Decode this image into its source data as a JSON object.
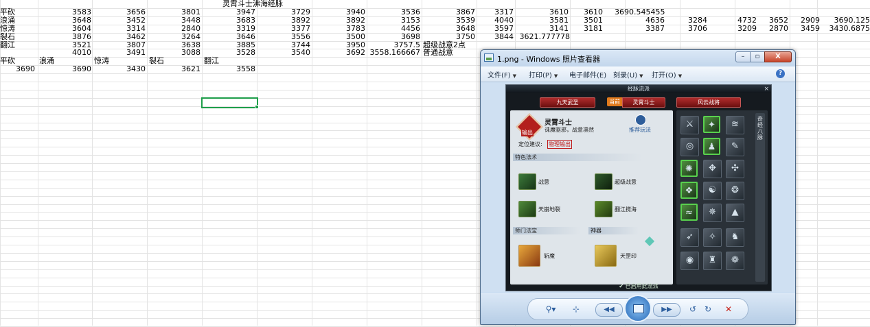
{
  "sheet": {
    "title": "灵霄斗士沸海经脉",
    "rows": [
      {
        "label": "平砍",
        "values": [
          "3583",
          "3656",
          "3801",
          "3947",
          "3729",
          "3940",
          "3536",
          "3867",
          "3317",
          "3610",
          "3610",
          "3690.545455"
        ]
      },
      {
        "label": "浪涌",
        "values": [
          "3648",
          "3452",
          "3448",
          "3683",
          "3892",
          "3892",
          "3153",
          "3539",
          "4040",
          "3581",
          "3501",
          "4636",
          "3284",
          "4732",
          "3652",
          "2909",
          "3690.125"
        ]
      },
      {
        "label": "惊涛",
        "values": [
          "3604",
          "3314",
          "2840",
          "3319",
          "3377",
          "3783",
          "4456",
          "3648",
          "3597",
          "3141",
          "3181",
          "3387",
          "3706",
          "3209",
          "2870",
          "3459",
          "3430.6875"
        ]
      },
      {
        "label": "裂石",
        "values": [
          "3876",
          "3462",
          "3264",
          "3646",
          "3556",
          "3500",
          "3698",
          "3750",
          "3844",
          "3621.777778"
        ]
      },
      {
        "label": "翻江",
        "values": [
          "3521",
          "3807",
          "3638",
          "3885",
          "3744",
          "3950",
          "3757.5"
        ],
        "note": "超级战意2点"
      },
      {
        "label": "",
        "values": [
          "4010",
          "3491",
          "3088",
          "3528",
          "3540",
          "3692",
          "3558.166667"
        ],
        "note": "普通战意"
      }
    ],
    "summary_headers": [
      "平砍",
      "浪涌",
      "惊涛",
      "裂石",
      "翻江"
    ],
    "summary_values": [
      "3690",
      "3690",
      "3430",
      "3621",
      "3558"
    ]
  },
  "viewer": {
    "title": "1.png - Windows 照片查看器",
    "menu": [
      "文件(F)",
      "打印(P)",
      "电子邮件(E)",
      "刻录(U)",
      "打开(O)"
    ],
    "help": "?",
    "min": "–",
    "max": "▫",
    "close": "X",
    "toolbar": {
      "zoom": "⚲▾",
      "fit": "⊹",
      "prev": "◀◀",
      "next": "▶▶",
      "rotate_left": "↺",
      "rotate_right": "↻",
      "delete": "✕"
    }
  },
  "game": {
    "title": "经脉流派",
    "close": "×",
    "tabs": [
      "九天武圣",
      "灵霄斗士",
      "风云战将"
    ],
    "current_badge": "当前",
    "role_name": "灵霄斗士",
    "role_desc": "诛魔驱邪，战意凛然",
    "role_tag": "输出",
    "recommend": "推荐玩法",
    "position_label": "定位建议:",
    "position_value": "物理输出",
    "section_skills": "特色法术",
    "skills": [
      "战意",
      "超级战意",
      "天崩地裂",
      "翻江搅海"
    ],
    "section_treasure": "师门法宝",
    "section_artifact": "神器",
    "treasure": "斩魔",
    "artifact": "天罡印",
    "side_label": "奇经八脉",
    "bottom": "已启用此流派"
  }
}
